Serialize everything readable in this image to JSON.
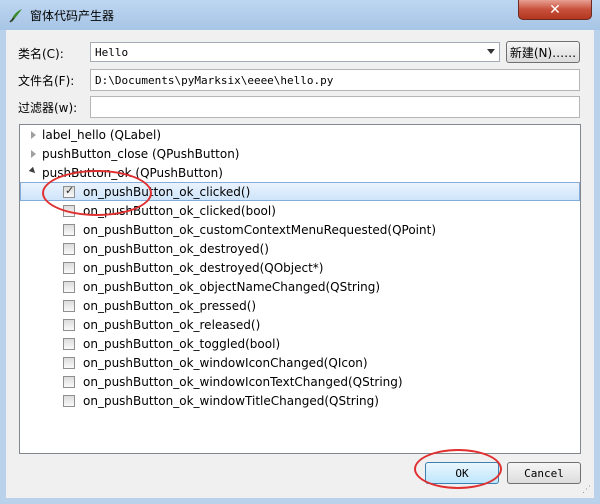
{
  "window": {
    "title": "窗体代码产生器",
    "close_label": "✕"
  },
  "form": {
    "class_label": "类名(C):",
    "class_value": "Hello",
    "new_button_label": "新建(N)……",
    "filename_label": "文件名(F):",
    "filename_value": "D:\\Documents\\pyMarksix\\eeee\\hello.py",
    "filter_label": "过滤器(w):",
    "filter_value": ""
  },
  "tree": {
    "groups": [
      {
        "label": "label_hello (QLabel)",
        "expanded": false
      },
      {
        "label": "pushButton_close (QPushButton)",
        "expanded": false
      },
      {
        "label": "pushButton_ok (QPushButton)",
        "expanded": true
      }
    ],
    "items": [
      {
        "label": "on_pushButton_ok_clicked()",
        "checked": true,
        "selected": true
      },
      {
        "label": "on_pushButton_ok_clicked(bool)",
        "checked": false
      },
      {
        "label": "on_pushButton_ok_customContextMenuRequested(QPoint)",
        "checked": false
      },
      {
        "label": "on_pushButton_ok_destroyed()",
        "checked": false
      },
      {
        "label": "on_pushButton_ok_destroyed(QObject*)",
        "checked": false
      },
      {
        "label": "on_pushButton_ok_objectNameChanged(QString)",
        "checked": false
      },
      {
        "label": "on_pushButton_ok_pressed()",
        "checked": false
      },
      {
        "label": "on_pushButton_ok_released()",
        "checked": false
      },
      {
        "label": "on_pushButton_ok_toggled(bool)",
        "checked": false
      },
      {
        "label": "on_pushButton_ok_windowIconChanged(QIcon)",
        "checked": false
      },
      {
        "label": "on_pushButton_ok_windowIconTextChanged(QString)",
        "checked": false
      },
      {
        "label": "on_pushButton_ok_windowTitleChanged(QString)",
        "checked": false
      }
    ]
  },
  "buttons": {
    "ok_label": "OK",
    "cancel_label": "Cancel"
  },
  "annotation_color": "#e03030"
}
